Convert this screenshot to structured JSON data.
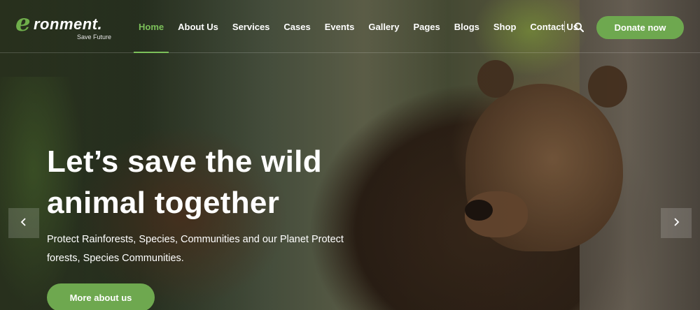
{
  "header": {
    "logo": {
      "mark": "e",
      "name": "ronment.",
      "tagline": "Save Future"
    },
    "nav": [
      {
        "label": "Home",
        "active": true
      },
      {
        "label": "About Us"
      },
      {
        "label": "Services"
      },
      {
        "label": "Cases"
      },
      {
        "label": "Events"
      },
      {
        "label": "Gallery"
      },
      {
        "label": "Pages"
      },
      {
        "label": "Blogs"
      },
      {
        "label": "Shop"
      },
      {
        "label": "Contact Us"
      }
    ],
    "search_icon": "search-icon",
    "donate_label": "Donate now"
  },
  "hero": {
    "headline_line1": "Let’s save the wild",
    "headline_line2": "animal together",
    "subtext_line1": "Protect Rainforests, Species, Communities and our Planet Protect",
    "subtext_line2": "forests, Species Communities.",
    "cta_label": "More about us",
    "prev_icon": "chevron-left-icon",
    "next_icon": "chevron-right-icon"
  },
  "colors": {
    "accent": "#6ea84f",
    "active_nav": "#7cc05a",
    "text": "#ffffff"
  }
}
